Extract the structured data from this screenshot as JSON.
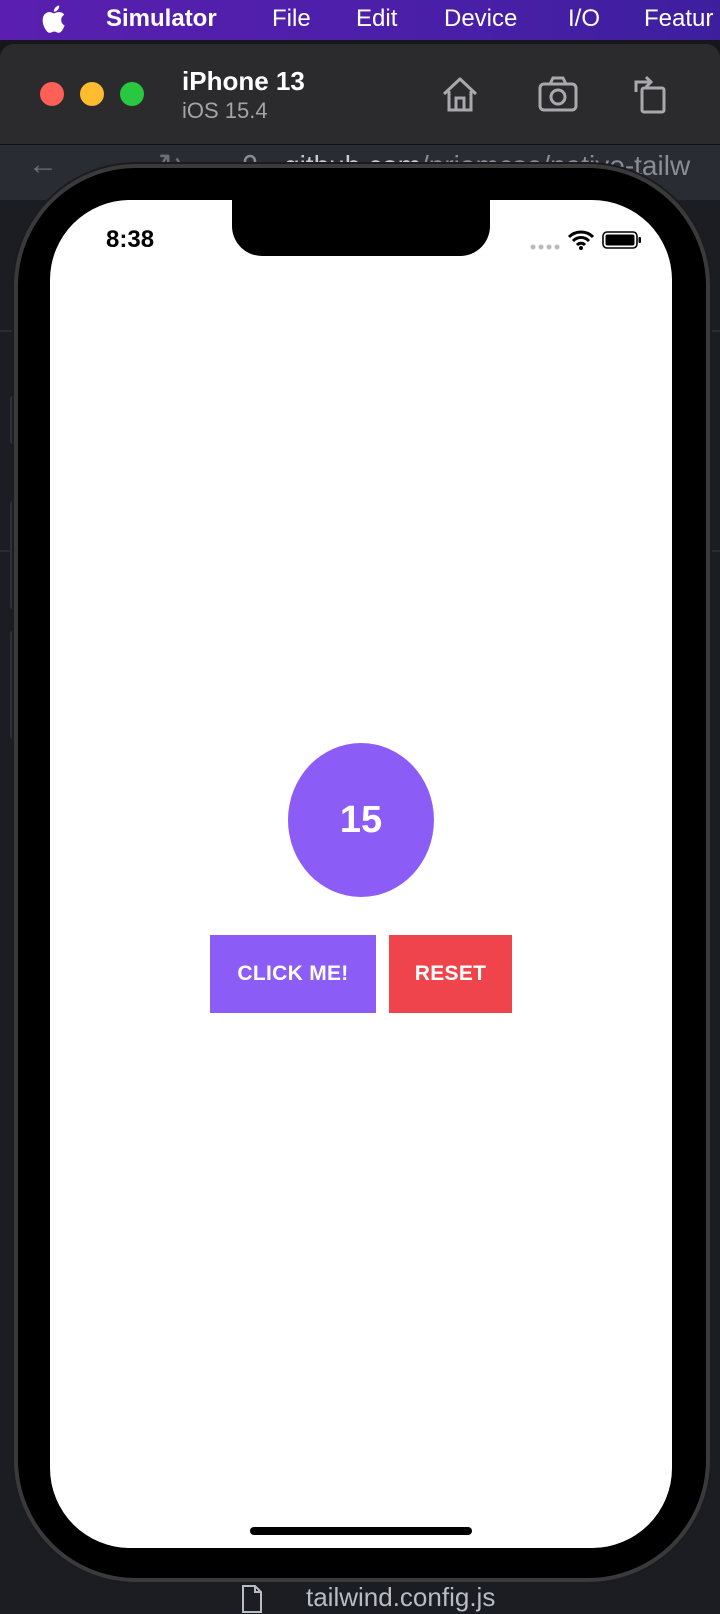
{
  "menubar": {
    "app_name": "Simulator",
    "items": [
      "File",
      "Edit",
      "Device",
      "I/O",
      "Featur"
    ]
  },
  "browser": {
    "url_host": "github.com",
    "url_path": "/priamcse/native-tailw",
    "footer_file": "tailwind.config.js"
  },
  "simulator": {
    "device_name": "iPhone 13",
    "os_version": "iOS 15.4",
    "toolbar_icons": [
      "home-icon",
      "screenshot-icon",
      "rotate-icon"
    ]
  },
  "status_bar": {
    "time": "8:38"
  },
  "app": {
    "counter_value": "15",
    "click_label": "CLICK ME!",
    "reset_label": "RESET"
  },
  "colors": {
    "accent": "#8b5cf6",
    "danger": "#ef444c",
    "menubar": "#4a1fa8"
  }
}
